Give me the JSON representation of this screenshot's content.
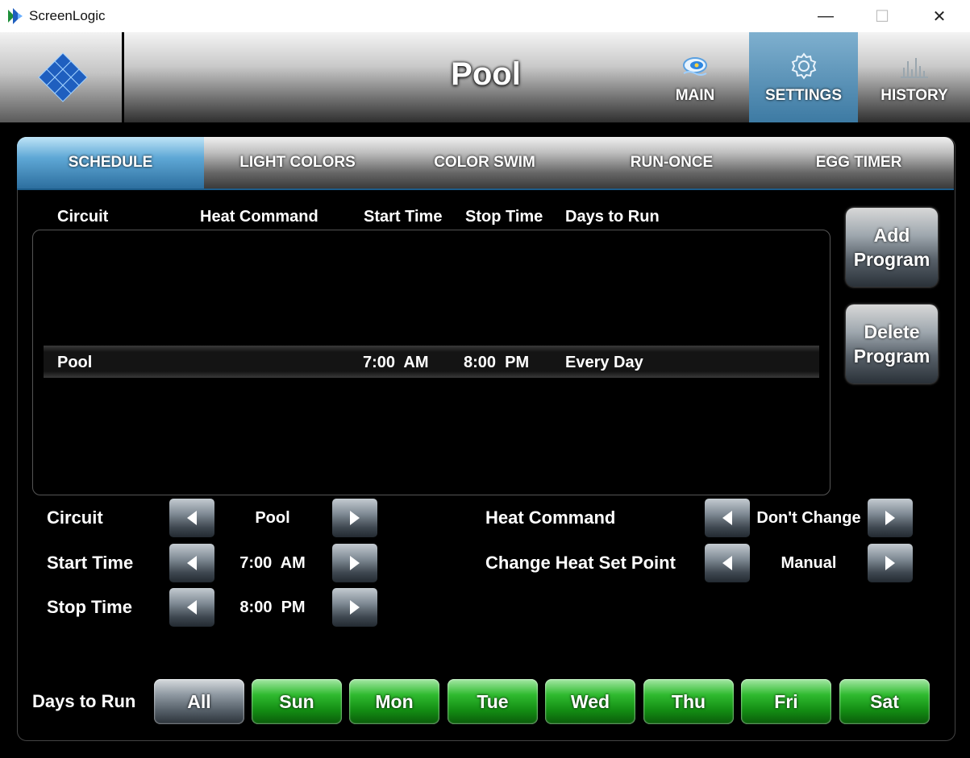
{
  "window": {
    "title": "ScreenLogic",
    "minimize": "—",
    "maximize": "☐",
    "close": "✕"
  },
  "header": {
    "page_title": "Pool",
    "nav": [
      {
        "label": "MAIN",
        "icon": "pool-icon"
      },
      {
        "label": "SETTINGS",
        "icon": "gear-icon",
        "active": true
      },
      {
        "label": "HISTORY",
        "icon": "bar-chart-icon"
      }
    ]
  },
  "tabs": [
    {
      "label": "SCHEDULE",
      "active": true
    },
    {
      "label": "LIGHT COLORS"
    },
    {
      "label": "COLOR SWIM"
    },
    {
      "label": "RUN-ONCE"
    },
    {
      "label": "EGG TIMER"
    }
  ],
  "schedule": {
    "columns": [
      "Circuit",
      "Heat Command",
      "Start Time",
      "Stop Time",
      "Days to Run"
    ],
    "rows": [
      {
        "circuit": "Pool",
        "heat_command": "",
        "start_time": "7:00  AM",
        "stop_time": "8:00  PM",
        "days": "Every Day"
      }
    ]
  },
  "actions": {
    "add_line1": "Add",
    "add_line2": "Program",
    "delete_line1": "Delete",
    "delete_line2": "Program"
  },
  "editor": {
    "circuit_label": "Circuit",
    "circuit_value": "Pool",
    "start_label": "Start Time",
    "start_value": "7:00  AM",
    "stop_label": "Stop Time",
    "stop_value": "8:00  PM",
    "heat_label": "Heat Command",
    "heat_value": "Don't Change",
    "setpoint_label": "Change Heat Set Point",
    "setpoint_value": "Manual"
  },
  "days": {
    "label": "Days to Run",
    "all": "All",
    "items": [
      "Sun",
      "Mon",
      "Tue",
      "Wed",
      "Thu",
      "Fri",
      "Sat"
    ]
  },
  "colors": {
    "accent_blue": "#3d7aa3",
    "day_green": "#1fa31f"
  }
}
